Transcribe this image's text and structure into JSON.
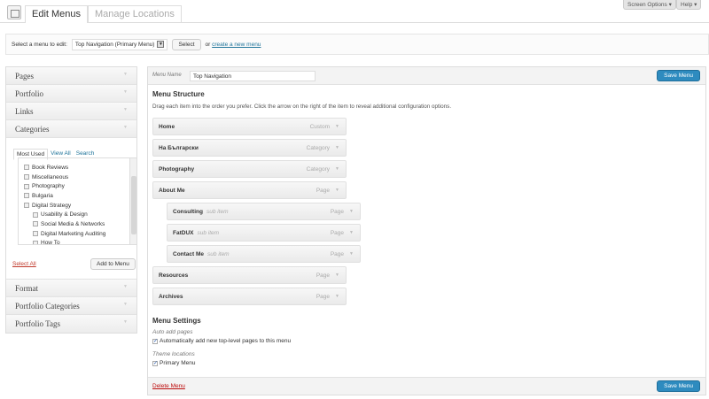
{
  "top": {
    "screen_options": "Screen Options ▾",
    "help": "Help ▾"
  },
  "tabs": [
    {
      "label": "Edit Menus",
      "active": true
    },
    {
      "label": "Manage Locations",
      "active": false
    }
  ],
  "select_bar": {
    "label": "Select a menu to edit:",
    "value": "Top Navigation (Primary Menu)",
    "select_button": "Select",
    "or_text": "or",
    "create_link": "create a new menu"
  },
  "sidebar": {
    "sections_top": [
      "Pages",
      "Portfolio",
      "Links",
      "Categories"
    ],
    "categories": {
      "tabs": [
        "Most Used",
        "View All",
        "Search"
      ],
      "items": [
        {
          "label": "Book Reviews",
          "sub": false
        },
        {
          "label": "Miscellaneous",
          "sub": false
        },
        {
          "label": "Photography",
          "sub": false
        },
        {
          "label": "Bulgaria",
          "sub": false
        },
        {
          "label": "Digital Strategy",
          "sub": false
        },
        {
          "label": "Usability & Design",
          "sub": true
        },
        {
          "label": "Social Media & Networks",
          "sub": true
        },
        {
          "label": "Digital Marketing Auditing",
          "sub": true
        },
        {
          "label": "How To",
          "sub": true
        }
      ],
      "select_all": "Select All",
      "add_button": "Add to Menu"
    },
    "sections_bottom": [
      "Format",
      "Portfolio Categories",
      "Portfolio Tags"
    ]
  },
  "main": {
    "menu_name_label": "Menu Name",
    "menu_name_value": "Top Navigation",
    "save_button": "Save Menu",
    "structure_title": "Menu Structure",
    "structure_help": "Drag each item into the order you prefer. Click the arrow on the right of the item to reveal additional configuration options.",
    "items": [
      {
        "title": "Home",
        "type": "Custom",
        "depth": 0
      },
      {
        "title": "На Български",
        "type": "Category",
        "depth": 0
      },
      {
        "title": "Photography",
        "type": "Category",
        "depth": 0
      },
      {
        "title": "About Me",
        "type": "Page",
        "depth": 0
      },
      {
        "title": "Consulting",
        "type": "Page",
        "depth": 1,
        "sub": "sub item"
      },
      {
        "title": "FatDUX",
        "type": "Page",
        "depth": 1,
        "sub": "sub item"
      },
      {
        "title": "Contact Me",
        "type": "Page",
        "depth": 1,
        "sub": "sub item"
      },
      {
        "title": "Resources",
        "type": "Page",
        "depth": 0
      },
      {
        "title": "Archives",
        "type": "Page",
        "depth": 0
      }
    ],
    "settings_title": "Menu Settings",
    "auto_add_label": "Auto add pages",
    "auto_add_text": "Automatically add new top-level pages to this menu",
    "auto_add_checked": true,
    "theme_locations_label": "Theme locations",
    "primary_menu_text": "Primary Menu",
    "primary_menu_checked": true,
    "delete_link": "Delete Menu"
  },
  "colors": {
    "accent": "#2e8bbf",
    "link": "#21759b",
    "delete": "#bc0b0b"
  }
}
